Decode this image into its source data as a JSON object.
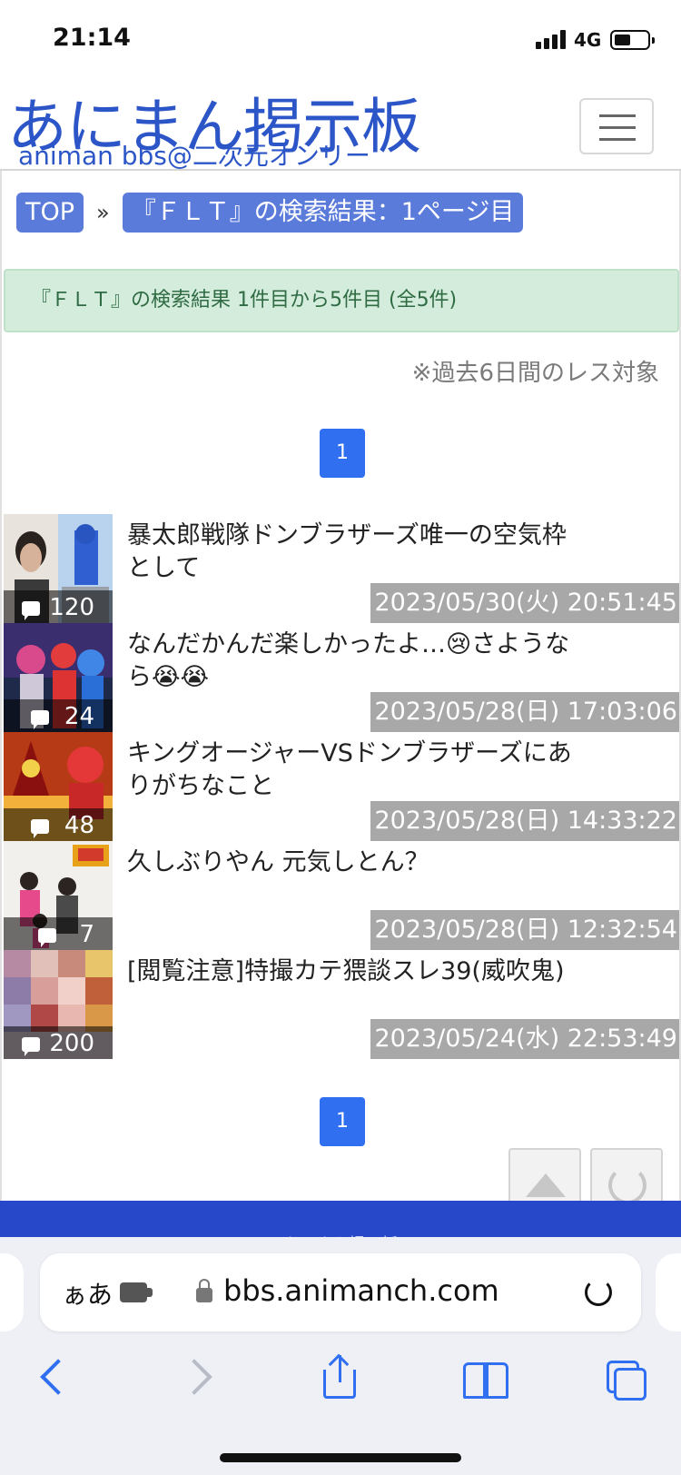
{
  "status_bar": {
    "time": "21:14",
    "network": "4G"
  },
  "header": {
    "logo_main": "あにまん掲示板",
    "logo_sub": "animan bbs@二次元オンリー"
  },
  "breadcrumb": {
    "top": "TOP",
    "separator": "»",
    "current": "『ＦＬＴ』の検索結果：1ページ目"
  },
  "alert": {
    "text": "『ＦＬＴ』の検索結果 1件目から5件目 (全5件)"
  },
  "note": "※過去6日間のレス対象",
  "pagination": {
    "page": "1"
  },
  "threads": [
    {
      "title": "暴太郎戦隊ドンブラザーズ唯一の空気枠として",
      "count": "120",
      "date": "2023/05/30(火) 20:51:45"
    },
    {
      "title": "なんだかんだ楽しかったよ…😢さようなら😭😭",
      "count": "24",
      "date": "2023/05/28(日) 17:03:06"
    },
    {
      "title": "キングオージャーVSドンブラザーズにありがちなこと",
      "count": "48",
      "date": "2023/05/28(日) 14:33:22"
    },
    {
      "title": "久しぶりやん 元気しとん？",
      "count": "7",
      "date": "2023/05/28(日) 12:32:54"
    },
    {
      "title": "[閲覧注意]特撮カテ猥談スレ39(威吹鬼)",
      "count": "200",
      "date": "2023/05/24(水) 22:53:49"
    }
  ],
  "footer": {
    "text": "あにまん掲示板"
  },
  "browser": {
    "aa": "ぁあ",
    "url": "bbs.animanch.com"
  },
  "colors": {
    "brand": "#2c56c8",
    "breadcrumb": "#5b7bdb",
    "pager": "#2f6ff0",
    "footer": "#2748c9",
    "alert_bg": "#d4ecdb",
    "date_bg": "#a8a8a8"
  }
}
